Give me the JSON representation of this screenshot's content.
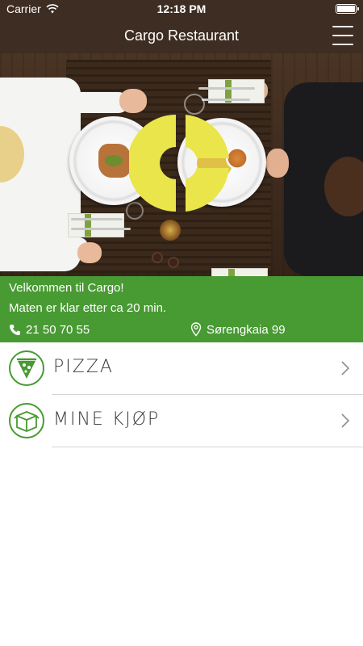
{
  "status_bar": {
    "carrier": "Carrier",
    "time": "12:18 PM",
    "icons": [
      "wifi-icon",
      "battery-icon"
    ],
    "battery_level_percent": 100
  },
  "nav": {
    "title": "Cargo Restaurant",
    "menu_icon": "hamburger-menu-icon"
  },
  "hero": {
    "image": "restaurant-table-photo",
    "logo": "cargo-logo",
    "logo_color": "#e9e54a"
  },
  "info": {
    "welcome": "Velkommen til Cargo!",
    "wait_time": "Maten er klar etter ca 20 min.",
    "phone": "21 50 70 55",
    "phone_icon": "phone-icon",
    "address": "Sørengkaia 99",
    "address_icon": "location-pin-icon"
  },
  "menu": {
    "items": [
      {
        "label": "PIZZA",
        "icon": "pizza-slice-icon"
      },
      {
        "label": "MINE KJØP",
        "icon": "package-box-icon"
      }
    ],
    "chevron_icon": "chevron-right-icon"
  },
  "colors": {
    "brand_brown": "#3e2d22",
    "brand_green": "#489a33",
    "logo_yellow": "#e9e54a"
  }
}
